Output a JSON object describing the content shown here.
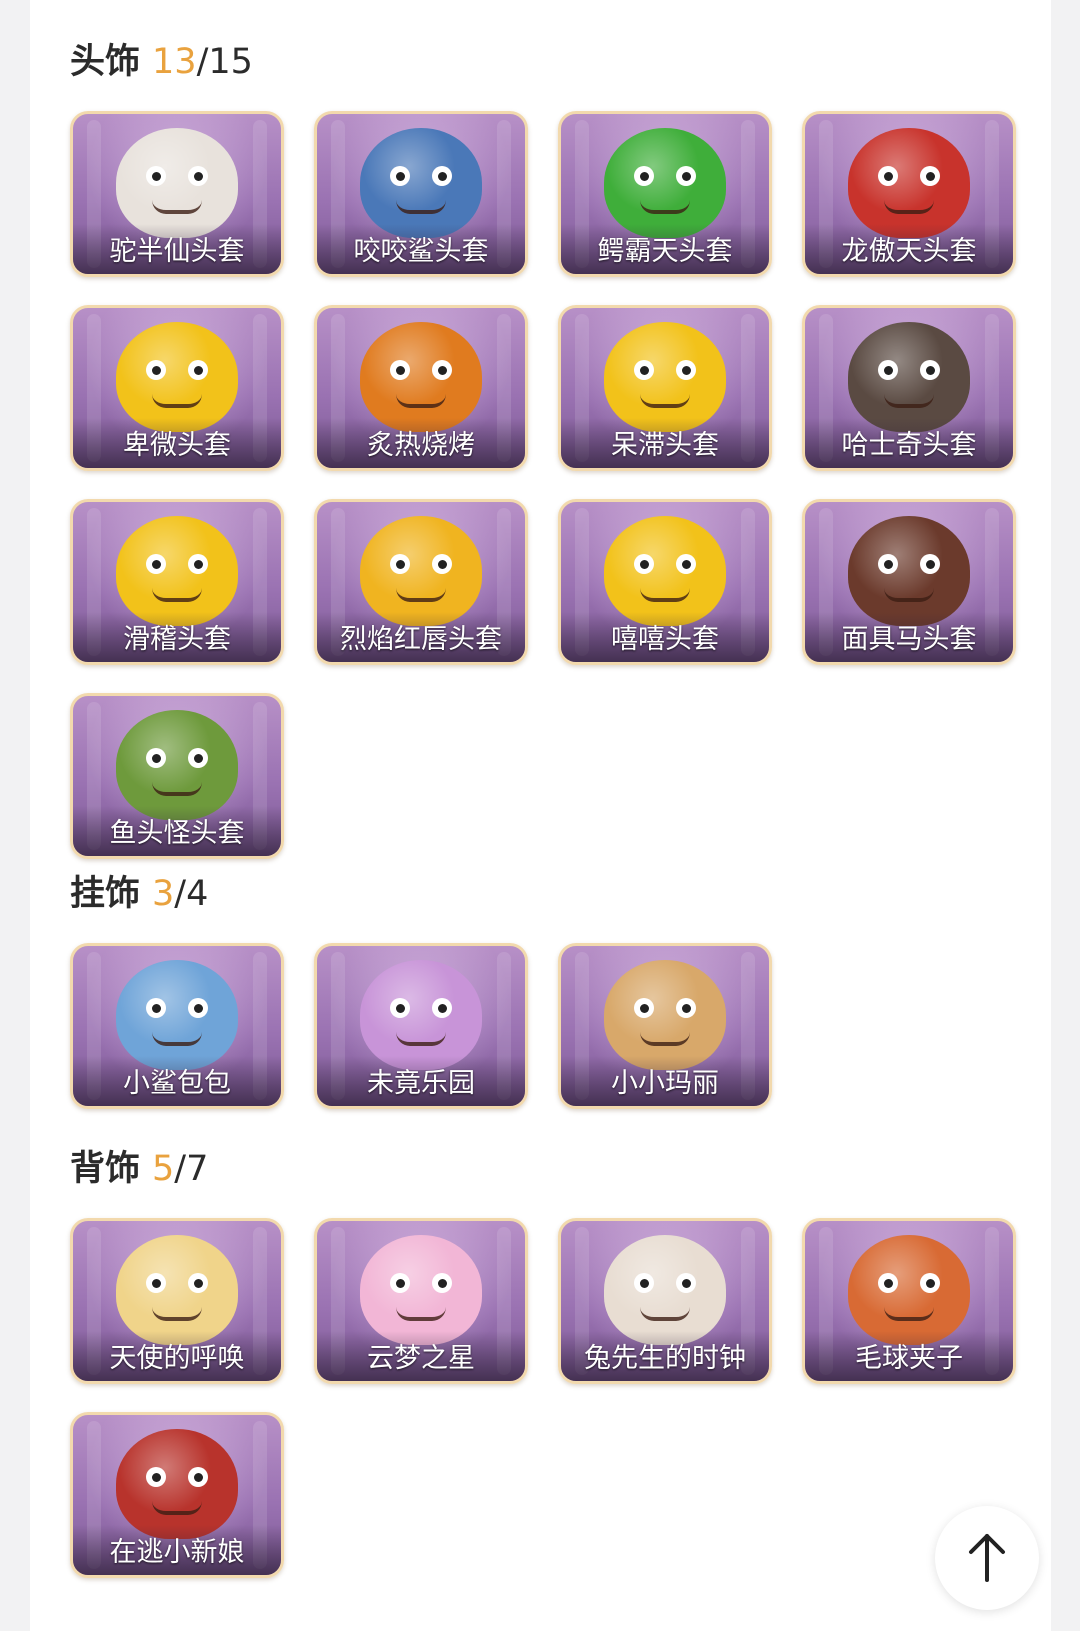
{
  "sections": [
    {
      "name": "头饰",
      "owned": "13",
      "separator": "/",
      "total": "15",
      "items": [
        {
          "label": "驼半仙头套",
          "color": "#e8e2dc"
        },
        {
          "label": "咬咬鲨头套",
          "color": "#4a78b8"
        },
        {
          "label": "鳄霸天头套",
          "color": "#3fae3a"
        },
        {
          "label": "龙傲天头套",
          "color": "#c8332c"
        },
        {
          "label": "卑微头套",
          "color": "#f2c21a"
        },
        {
          "label": "炙热烧烤",
          "color": "#e07b1f"
        },
        {
          "label": "呆滞头套",
          "color": "#f2c21a"
        },
        {
          "label": "哈士奇头套",
          "color": "#5a4a42"
        },
        {
          "label": "滑稽头套",
          "color": "#f2c21a"
        },
        {
          "label": "烈焰红唇头套",
          "color": "#f0b420"
        },
        {
          "label": "嘻嘻头套",
          "color": "#f2c21a"
        },
        {
          "label": "面具马头套",
          "color": "#6b3a2c"
        },
        {
          "label": "鱼头怪头套",
          "color": "#6e9a3c"
        }
      ]
    },
    {
      "name": "挂饰",
      "owned": "3",
      "separator": "/",
      "total": "4",
      "items": [
        {
          "label": "小鲨包包",
          "color": "#6fa4d8"
        },
        {
          "label": "未竟乐园",
          "color": "#c894d8"
        },
        {
          "label": "小小玛丽",
          "color": "#d8a86a"
        }
      ]
    },
    {
      "name": "背饰",
      "owned": "5",
      "separator": "/",
      "total": "7",
      "items": [
        {
          "label": "天使的呼唤",
          "color": "#f0d48a"
        },
        {
          "label": "云梦之星",
          "color": "#f2b6d6"
        },
        {
          "label": "兔先生的时钟",
          "color": "#e8ddd2"
        },
        {
          "label": "毛球夹子",
          "color": "#d86a34"
        },
        {
          "label": "在逃小新娘",
          "color": "#b8332c"
        }
      ]
    }
  ],
  "back_to_top_icon": "arrow-up-icon"
}
